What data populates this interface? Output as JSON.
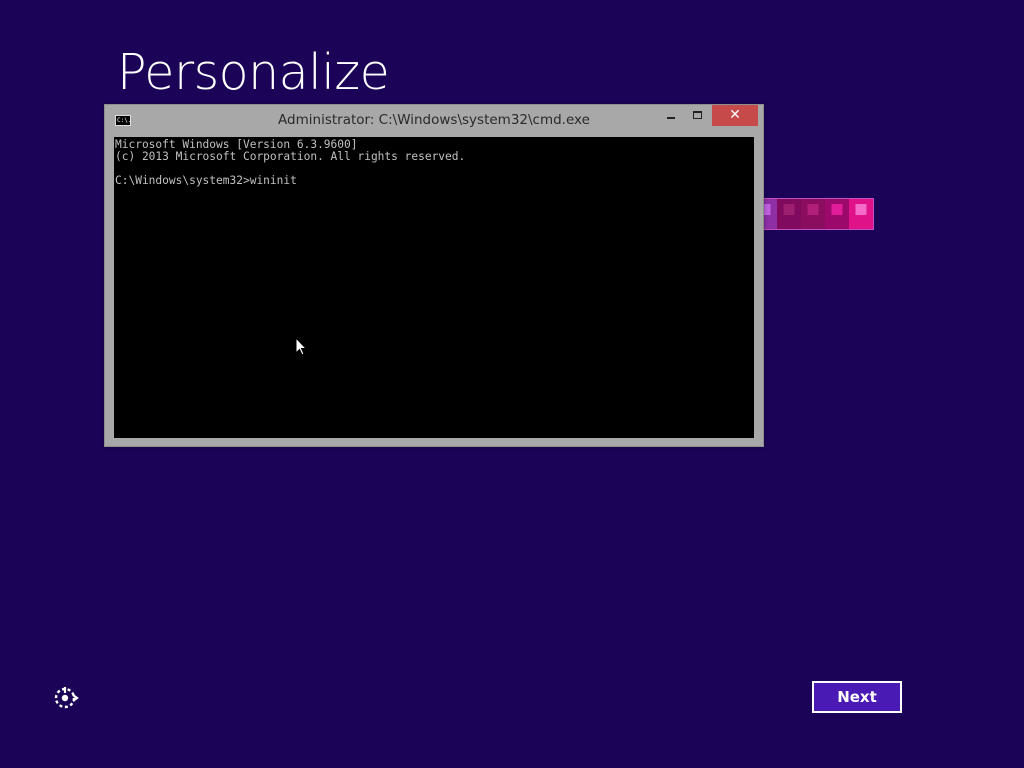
{
  "page": {
    "title": "Personalize",
    "background_color": "#1b0458",
    "next_label": "Next",
    "ease_of_access_icon": "ease-of-access-icon"
  },
  "color_swatches": [
    {
      "color": "#8e2fa6",
      "dot_color": "#c060e0"
    },
    {
      "color": "#7f0a5e",
      "dot_color": "#9c1f70"
    },
    {
      "color": "#8a0d5f",
      "dot_color": "#b0207a"
    },
    {
      "color": "#9b0a6a",
      "dot_color": "#e11e9a"
    },
    {
      "color": "#e0128a",
      "dot_color": "#f56bc8"
    }
  ],
  "cmd_window": {
    "title": "Administrator: C:\\Windows\\system32\\cmd.exe",
    "app_icon": "cmd-app-icon",
    "app_icon_text": "C:\\.",
    "minimize_icon": "minimize-icon",
    "maximize_icon": "maximize-icon",
    "close_icon": "close-icon",
    "close_glyph": "✕",
    "close_button_color": "#c74a4a",
    "console_lines": [
      "Microsoft Windows [Version 6.3.9600]",
      "(c) 2013 Microsoft Corporation. All rights reserved.",
      "",
      "C:\\Windows\\system32>wininit"
    ]
  }
}
